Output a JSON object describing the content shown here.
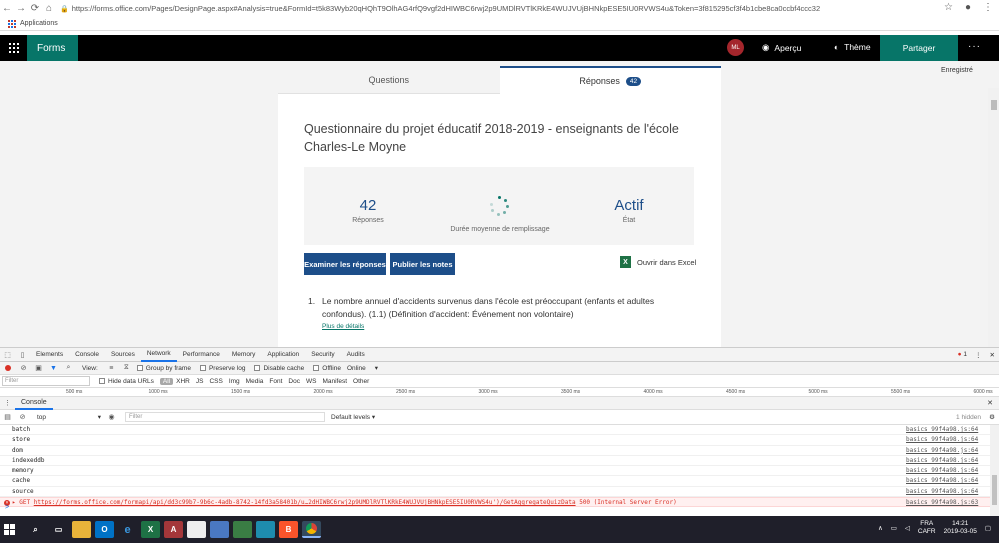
{
  "browser": {
    "url": "https://forms.office.com/Pages/DesignPage.aspx#Analysis=true&FormId=t5k83Wyb20qHQhT9OlhAG4rfQ9vgf2dHIWBC6rwj2p9UMDlRVTlKRkE4WUJVUjBHNkpESE5IU0RVWS4u&Token=3f815295cf3f4b1cbe8ca0ccbf4ccc32",
    "bookmarks_label": "Applications"
  },
  "forms_header": {
    "brand": "Forms",
    "avatar": "ML",
    "preview": "Aperçu",
    "theme": "Thème",
    "share": "Partager",
    "more": "···"
  },
  "saved_status": "Enregistré",
  "tabs": {
    "questions": "Questions",
    "responses": "Réponses",
    "responses_count": "42"
  },
  "form": {
    "title": "Questionnaire du projet éducatif 2018-2019 - enseignants de l'école Charles-Le Moyne",
    "stats": {
      "responses_value": "42",
      "responses_label": "Réponses",
      "duration_label": "Durée moyenne de remplissage",
      "status_value": "Actif",
      "status_label": "État"
    },
    "buttons": {
      "review": "Examiner les réponses",
      "publish": "Publier les notes",
      "excel": "Ouvrir dans Excel"
    },
    "question": {
      "number": "1.",
      "text": "Le nombre annuel d'accidents survenus dans l'école est préoccupant (enfants et adultes confondus). (1.1) (Définition d'accident: Événement non volontaire)",
      "details_link": "Plus de détails"
    }
  },
  "devtools": {
    "tabs": [
      "Elements",
      "Console",
      "Sources",
      "Network",
      "Performance",
      "Memory",
      "Application",
      "Security",
      "Audits"
    ],
    "active_tab": "Network",
    "error_count": "1",
    "network": {
      "view": "View:",
      "group_by_frame": "Group by frame",
      "preserve_log": "Preserve log",
      "disable_cache": "Disable cache",
      "offline": "Offline",
      "throttle": "Online"
    },
    "filter": {
      "placeholder": "Filter",
      "hide_data_urls": "Hide data URLs",
      "types": [
        "All",
        "XHR",
        "JS",
        "CSS",
        "Img",
        "Media",
        "Font",
        "Doc",
        "WS",
        "Manifest",
        "Other"
      ]
    },
    "timeline_ticks": [
      "500 ms",
      "1000 ms",
      "1500 ms",
      "2000 ms",
      "2500 ms",
      "3000 ms",
      "3500 ms",
      "4000 ms",
      "4500 ms",
      "5000 ms",
      "5500 ms",
      "6000 ms"
    ],
    "drawer_tab": "Console",
    "console": {
      "context": "top",
      "filter_placeholder": "Filter",
      "levels": "Default levels ▾",
      "hidden": "1 hidden"
    },
    "log_rows": [
      {
        "text": "batch",
        "source": "basics_99f4a98.js:64"
      },
      {
        "text": "store",
        "source": "basics_99f4a98.js:64"
      },
      {
        "text": "dom",
        "source": "basics_99f4a98.js:64"
      },
      {
        "text": "indexeddb",
        "source": "basics_99f4a98.js:64"
      },
      {
        "text": "memory",
        "source": "basics_99f4a98.js:64"
      },
      {
        "text": "cache",
        "source": "basics_99f4a98.js:64"
      },
      {
        "text": "source",
        "source": "basics_99f4a98.js:64"
      }
    ],
    "error_row": {
      "method": "GET",
      "url": "https://forms.office.com/formapi/api/dd3c99b7-9b6c-4adb-8742-14fd3a58401b/u…2dHIWBC6rwj2p9UMDlRVTlKRkE4WUJVUjBHNkpESE5IU0RVWS4u')/GetAggregateQuizData",
      "status": "500 (Internal Server Error)",
      "source": "basics_99f4a98.js:63"
    },
    "prompt": ">"
  },
  "taskbar": {
    "lang_top": "FRA",
    "lang_bottom": "CAFR",
    "time": "14:21",
    "date": "2019-03-05",
    "icon_labels": {
      "outlook": "O",
      "edge": "e",
      "excel": "X",
      "access": "A",
      "brave": "B"
    }
  },
  "colors": {
    "forms_teal": "#077568",
    "accent_blue": "#1d4e89",
    "error_red": "#d93025"
  }
}
